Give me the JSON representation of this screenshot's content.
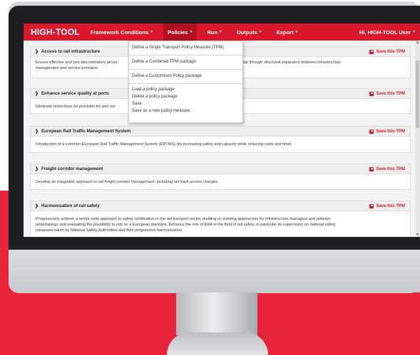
{
  "app": {
    "brand": "HIGH-TOOL",
    "accent": "#d9182d",
    "user_greeting": "Hi, HIGH-TOOL User"
  },
  "nav": [
    {
      "label": "Framework Conditions",
      "active": false
    },
    {
      "label": "Policies",
      "active": true
    },
    {
      "label": "Run",
      "active": false
    },
    {
      "label": "Outputs",
      "active": false
    },
    {
      "label": "Export",
      "active": false
    }
  ],
  "policies_menu": {
    "items": [
      "Define a Single Transport Policy Measure (TPM)",
      "Define a Combined TPM package",
      "Define a Customised Policy package",
      "Load a policy package",
      "Delete a policy package",
      "Save",
      "Save as a new policy measure"
    ]
  },
  "save_label": "Save this TPM",
  "measures": [
    {
      "title": "Access to rail infrastructure",
      "description_left": "Ensure effective and non-discriminatory acces",
      "description_right": "particular through structural separation between infrastructure",
      "description_line2": "management and service provision."
    },
    {
      "title": "Enhance service quality at ports",
      "description": "Eliminate restrictions on provision for port ser"
    },
    {
      "title": "European Rail Traffic Management System",
      "description": "Introduction of a common European Rail Traffic Management System (ERTMS) (by increasing safety and capacity while reducing costs and time)."
    },
    {
      "title": "Freight corridor management",
      "description": "Develop an integrated approach to rail freight corridor management, including rail track access charges."
    },
    {
      "title": "Harmonisation of rail safety",
      "description_line1": "Progressively achieve a sector-wide approach to safety certification in the rail transport sector, building on existing approaches for infrastructure managers and railways",
      "description_line2": "undertakings and evaluating the possibility to rely on a European standard. Enhance the role of ERA in the field of rail safety, in particular its supervision on national safety",
      "description_line3": "measures taken by National Safety Authorities and their progressive harmonisation."
    }
  ]
}
